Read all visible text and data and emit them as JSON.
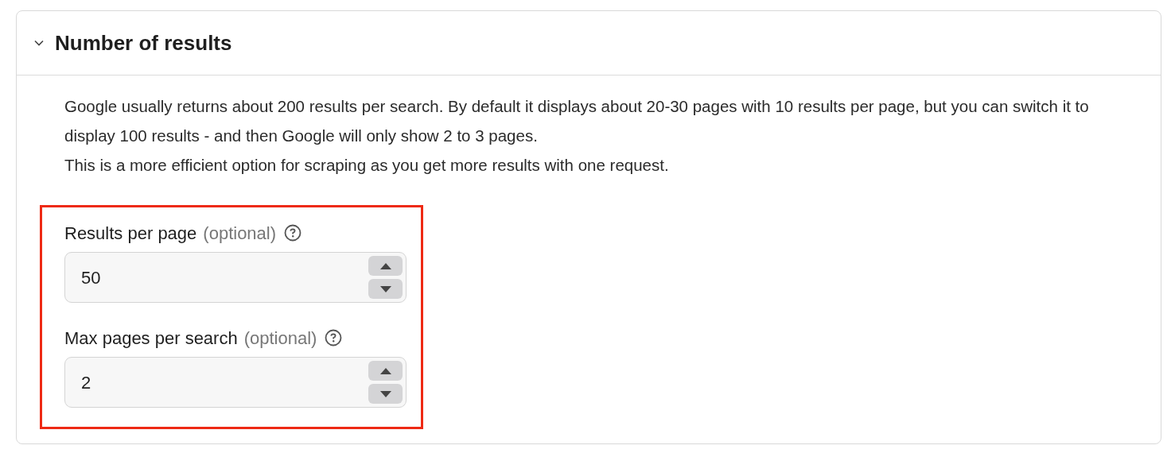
{
  "section": {
    "title": "Number of results",
    "expanded": true,
    "description": [
      "Google usually returns about 200 results per search. By default it displays about 20-30 pages with 10 results per page, but you can switch it to display 100 results - and then Google will only show 2 to 3 pages.",
      "This is a more efficient option for scraping as you get more results with one request."
    ],
    "highlighted": true,
    "fields": [
      {
        "label": "Results per page",
        "hint": "(optional)",
        "value": "50"
      },
      {
        "label": "Max pages per search",
        "hint": "(optional)",
        "value": "2"
      }
    ]
  }
}
